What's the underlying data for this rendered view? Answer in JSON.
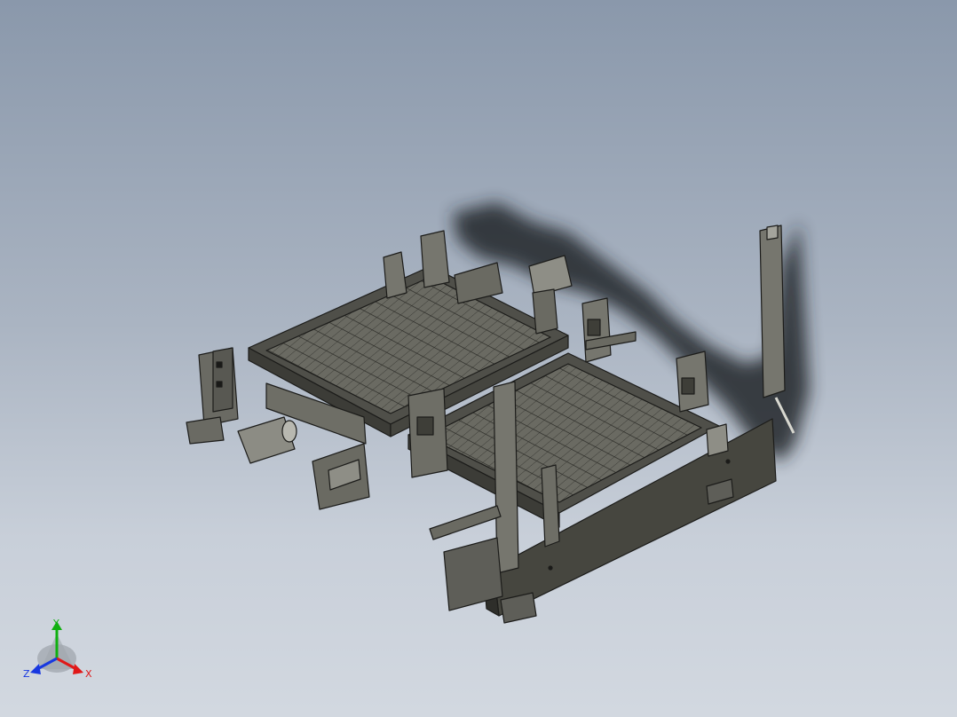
{
  "viewport": {
    "background_top": "#8a98ab",
    "background_bottom": "#d2d8e0"
  },
  "model": {
    "color": "#5c5c55",
    "edge_color": "#1c1c1a",
    "shadow_color": "#202428"
  },
  "triad": {
    "x_label": "X",
    "y_label": "Y",
    "z_label": "Z",
    "x_color": "#e01818",
    "y_color": "#10b010",
    "z_color": "#1838e0"
  }
}
